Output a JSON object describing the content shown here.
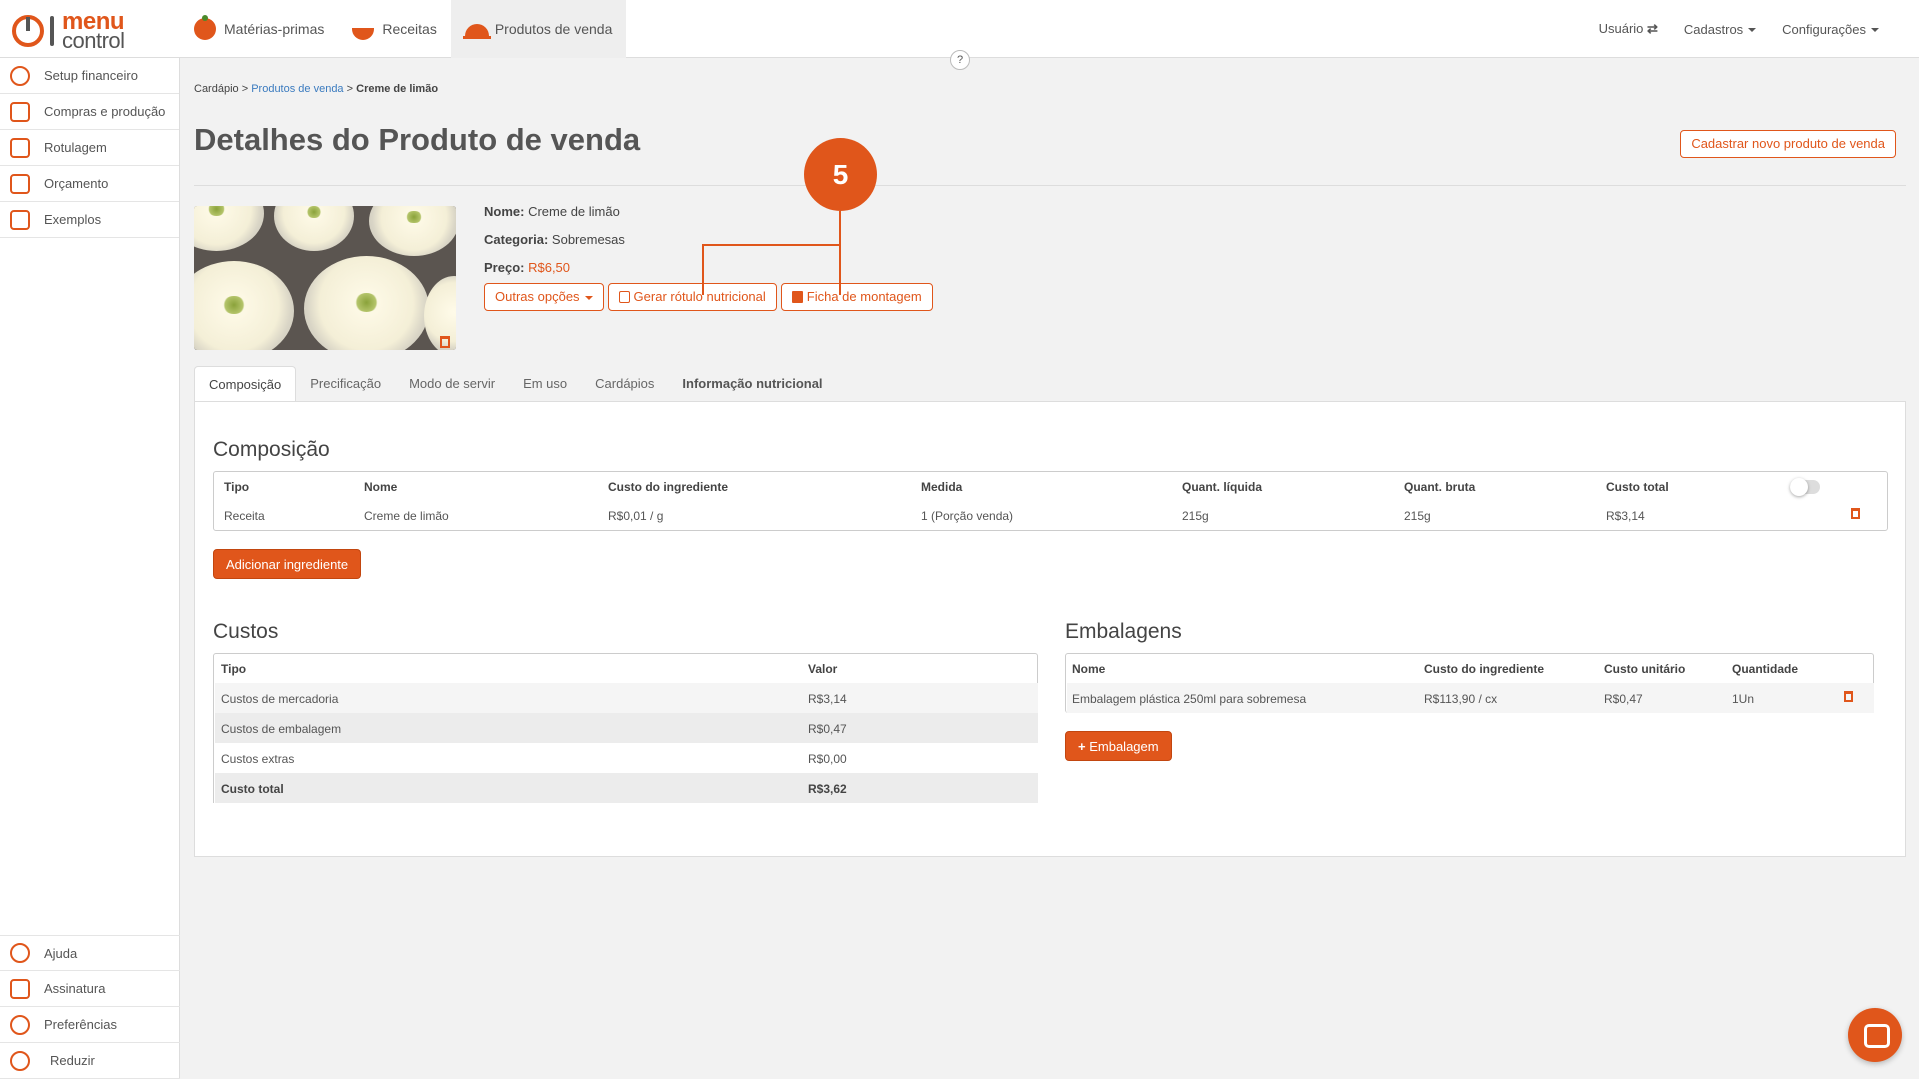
{
  "app": {
    "logo_text_top": "menu",
    "logo_text_bottom": "control",
    "accent_color": "#e0561b"
  },
  "topnav": [
    {
      "label": "Matérias-primas",
      "icon": "tomato-icon"
    },
    {
      "label": "Receitas",
      "icon": "bowl-icon"
    },
    {
      "label": "Produtos de venda",
      "icon": "cloche-icon",
      "active": true
    }
  ],
  "topright": {
    "usuario": "Usuário",
    "cadastros": "Cadastros",
    "configuracoes": "Configurações"
  },
  "help_label": "?",
  "sidebar": {
    "items": [
      {
        "label": "Setup financeiro",
        "icon": "gear-dollar-icon"
      },
      {
        "label": "Compras e produção",
        "icon": "cart-icon"
      },
      {
        "label": "Rotulagem",
        "icon": "label-icon"
      },
      {
        "label": "Orçamento",
        "icon": "budget-icon"
      },
      {
        "label": "Exemplos",
        "icon": "examples-icon"
      }
    ],
    "bottom": [
      {
        "label": "Ajuda",
        "icon": "help-icon"
      },
      {
        "label": "Assinatura",
        "icon": "card-icon"
      },
      {
        "label": "Preferências",
        "icon": "gear-icon"
      },
      {
        "label": "Reduzir",
        "icon": "collapse-icon"
      }
    ]
  },
  "breadcrumb": {
    "root": "Cardápio",
    "sep1": ">",
    "link": "Produtos de venda",
    "sep2": ">",
    "current": "Creme de limão"
  },
  "page_title": "Detalhes do Produto de venda",
  "new_button": "Cadastrar novo produto de venda",
  "product": {
    "nome_label": "Nome:",
    "nome": "Creme de limão",
    "categoria_label": "Categoria:",
    "categoria": "Sobremesas",
    "preco_label": "Preço:",
    "preco": "R$6,50"
  },
  "actions": {
    "outras": "Outras opções",
    "rotulo": "Gerar rótulo nutricional",
    "ficha": "Ficha de montagem"
  },
  "callout_number": "5",
  "tabs": [
    {
      "label": "Composição",
      "active": true
    },
    {
      "label": "Precificação"
    },
    {
      "label": "Modo de servir"
    },
    {
      "label": "Em uso"
    },
    {
      "label": "Cardápios"
    },
    {
      "label": "Informação nutricional",
      "bold": true
    }
  ],
  "composicao": {
    "title": "Composição",
    "headers": [
      "Tipo",
      "Nome",
      "Custo do ingrediente",
      "Medida",
      "Quant. líquida",
      "Quant. bruta",
      "Custo total"
    ],
    "rows": [
      [
        "Receita",
        "Creme de limão",
        "R$0,01 / g",
        "1 (Porção venda)",
        "215g",
        "215g",
        "R$3,14"
      ]
    ],
    "add_button": "Adicionar ingrediente"
  },
  "custos": {
    "title": "Custos",
    "headers": [
      "Tipo",
      "Valor"
    ],
    "rows": [
      [
        "Custos de mercadoria",
        "R$3,14"
      ],
      [
        "Custos de embalagem",
        "R$0,47"
      ],
      [
        "Custos extras",
        "R$0,00"
      ],
      [
        "Custo total",
        "R$3,62"
      ]
    ]
  },
  "embalagens": {
    "title": "Embalagens",
    "headers": [
      "Nome",
      "Custo do ingrediente",
      "Custo unitário",
      "Quantidade"
    ],
    "rows": [
      [
        "Embalagem plástica 250ml para sobremesa",
        "R$113,90 / cx",
        "R$0,47",
        "1Un"
      ]
    ],
    "add_button": "Embalagem",
    "add_prefix": "+"
  }
}
